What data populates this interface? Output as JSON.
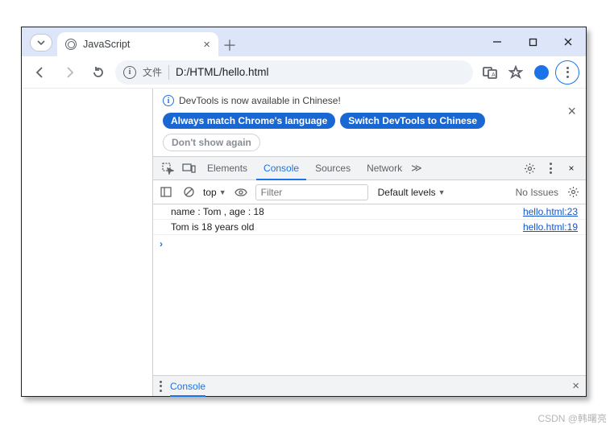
{
  "tabstrip": {
    "tab_title": "JavaScript"
  },
  "addrbar": {
    "file_label": "文件",
    "url": "D:/HTML/hello.html"
  },
  "notice": {
    "text": "DevTools is now available in Chinese!",
    "btn_always": "Always match Chrome's language",
    "btn_switch": "Switch DevTools to Chinese",
    "btn_dont": "Don't show again"
  },
  "dtTabs": {
    "elements": "Elements",
    "console": "Console",
    "sources": "Sources",
    "network": "Network"
  },
  "subbar": {
    "context": "top",
    "filter_placeholder": "Filter",
    "levels": "Default levels",
    "issues": "No Issues"
  },
  "logs": [
    {
      "msg": "name : Tom , age : 18",
      "src": "hello.html:23"
    },
    {
      "msg": "Tom is 18 years old",
      "src": "hello.html:19"
    }
  ],
  "drawer": {
    "tab": "Console"
  },
  "watermark": "CSDN @韩曙亮"
}
